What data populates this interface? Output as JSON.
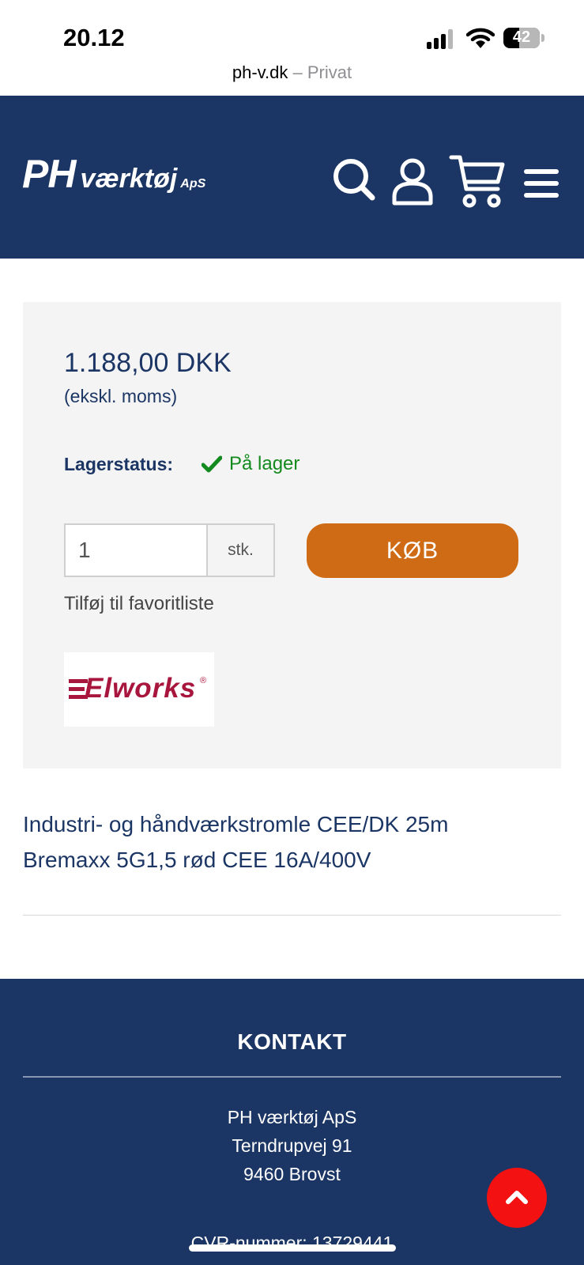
{
  "status_bar": {
    "time": "20.12",
    "battery": "42",
    "url_domain": "ph-v.dk",
    "url_separator": "–",
    "url_mode": "Privat"
  },
  "header": {
    "logo": {
      "main": "PH",
      "word": "værktøj",
      "suffix": "ApS"
    },
    "icons": [
      "search-icon",
      "user-icon",
      "cart-icon",
      "menu-icon"
    ],
    "background_color": "#1b3564"
  },
  "product": {
    "price": "1.188,00 DKK",
    "price_note": "(ekskl. moms)",
    "stock_label": "Lagerstatus:",
    "stock_value": "På lager",
    "quantity": "1",
    "unit": "stk.",
    "buy_label": "KØB",
    "favorite_label": "Tilføj til favoritliste",
    "brand": "Elworks",
    "brand_mark": "®",
    "title": "Industri- og håndværkstromle CEE/DK 25m Bremaxx 5G1,5 rød CEE 16A/400V"
  },
  "colors": {
    "navy": "#1b3564",
    "buy_button": "#cf6b14",
    "in_stock": "#138a1e",
    "scroll_top": "#f31111",
    "brand": "#a8163d"
  },
  "footer": {
    "heading": "KONTAKT",
    "company": "PH værktøj ApS",
    "street": "Terndrupvej 91",
    "city": "9460 Brovst",
    "cvr": "CVR-nummer: 13729441",
    "scroll_top_icon": "chevron-up-icon"
  }
}
